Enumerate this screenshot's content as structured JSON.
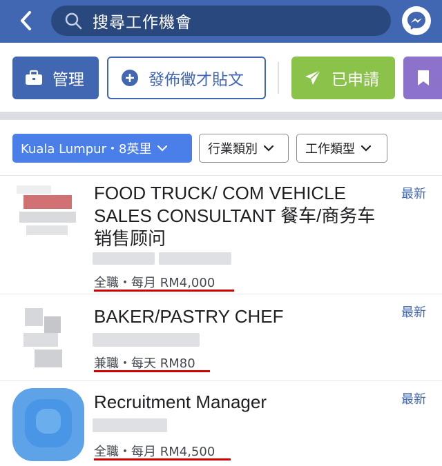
{
  "topbar": {
    "search_placeholder": "搜尋工作機會",
    "back_icon": "chevron-left-icon",
    "search_icon": "search-icon",
    "messenger_icon": "messenger-icon"
  },
  "actions": {
    "manage_label": "管理",
    "post_label": "發佈徵才貼文",
    "applied_label": "已申請"
  },
  "filters": {
    "location_label": "Kuala Lumpur・8英里",
    "industry_label": "行業類別",
    "jobtype_label": "工作類型"
  },
  "jobs": [
    {
      "title": "FOOD TRUCK/ COM VEHICLE SALES CONSULTANT 餐车/商务车销售顾问",
      "pay": "全職・每月 RM4,000",
      "new_tag": "最新"
    },
    {
      "title": "BAKER/PASTRY CHEF",
      "pay": "兼職・每天 RM80",
      "new_tag": "最新"
    },
    {
      "title": "Recruitment Manager",
      "pay": "全職・每月 RM4,500",
      "new_tag": "最新"
    }
  ],
  "colors": {
    "brand_blue": "#4267b2",
    "search_bg": "#29487d",
    "applied_green": "#8bc34a",
    "saved_purple": "#8c72cb",
    "location_chip": "#4a7ee8",
    "underline_red": "#d10000"
  }
}
